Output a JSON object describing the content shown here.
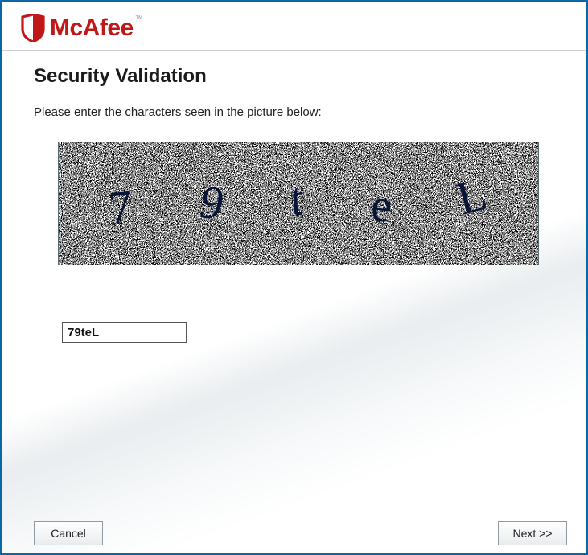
{
  "brand": {
    "name": "McAfee",
    "trademark": "™"
  },
  "page": {
    "title": "Security Validation",
    "instruction": "Please enter the characters seen in the picture below:"
  },
  "captcha": {
    "chars": [
      "7",
      "9",
      "t",
      "e",
      "L"
    ],
    "input_value": "79teL"
  },
  "buttons": {
    "cancel": "Cancel",
    "next": "Next >>"
  }
}
